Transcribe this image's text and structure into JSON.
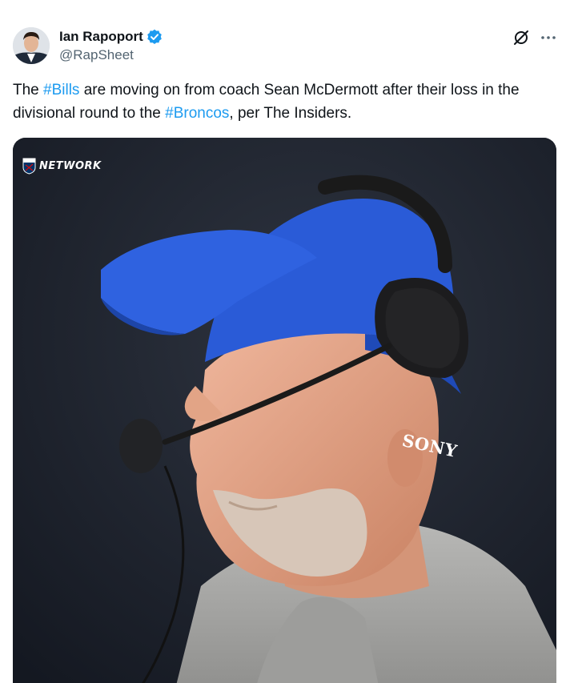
{
  "author": {
    "display_name": "Ian Rapoport",
    "handle": "@RapSheet",
    "verified": true
  },
  "icons": {
    "verified": "verified-badge-icon",
    "grok": "grok-icon",
    "more": "more-icon"
  },
  "tweet": {
    "part1": "The ",
    "hashtag1": "#Bills",
    "part2": " are moving on from coach Sean McDermott after their loss in the divisional round to the ",
    "hashtag2": "#Broncos",
    "part3": ", per The Insiders."
  },
  "media": {
    "watermark": "NETWORK",
    "headset_brand": "SONY"
  },
  "colors": {
    "link": "#1d9bf0",
    "text": "#0f1419",
    "secondary": "#536471",
    "cap_blue": "#2a5bd7"
  }
}
